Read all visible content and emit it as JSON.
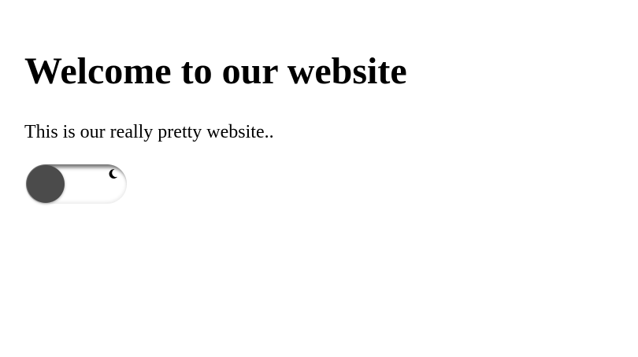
{
  "page": {
    "title": "Welcome to our website",
    "description": "This is our really pretty website.."
  },
  "theme_toggle": {
    "state": "off",
    "icon": "moon-icon",
    "colors": {
      "knob": "#4b4b4b",
      "track": "#ffffff",
      "icon": "#000000"
    }
  }
}
